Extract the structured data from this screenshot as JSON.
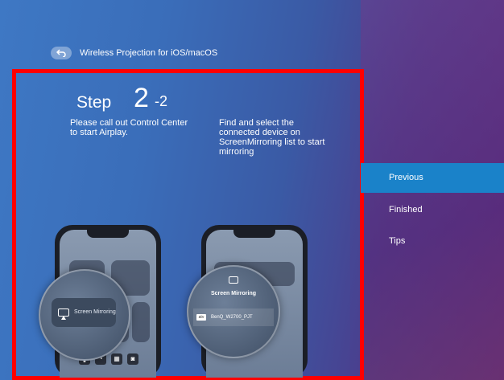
{
  "header": {
    "title": "Wireless Projection for iOS/macOS"
  },
  "step": {
    "word": "Step",
    "number": "2",
    "sub": "-2"
  },
  "instructions": {
    "left": "Please call out Control Center to start Airplay.",
    "right": "Find and select the connected device on ScreenMirroring list to start mirroring"
  },
  "phone1": {
    "tile_label": "Screen Mirroring"
  },
  "phone2": {
    "panel_title": "Screen Mirroring",
    "device_name": "BenQ_W2700_PJT",
    "badge": "atv"
  },
  "menu": {
    "previous": "Previous",
    "finished": "Finished",
    "tips": "Tips"
  },
  "colors": {
    "highlight": "#ff0000",
    "selected": "#1a82c9"
  }
}
